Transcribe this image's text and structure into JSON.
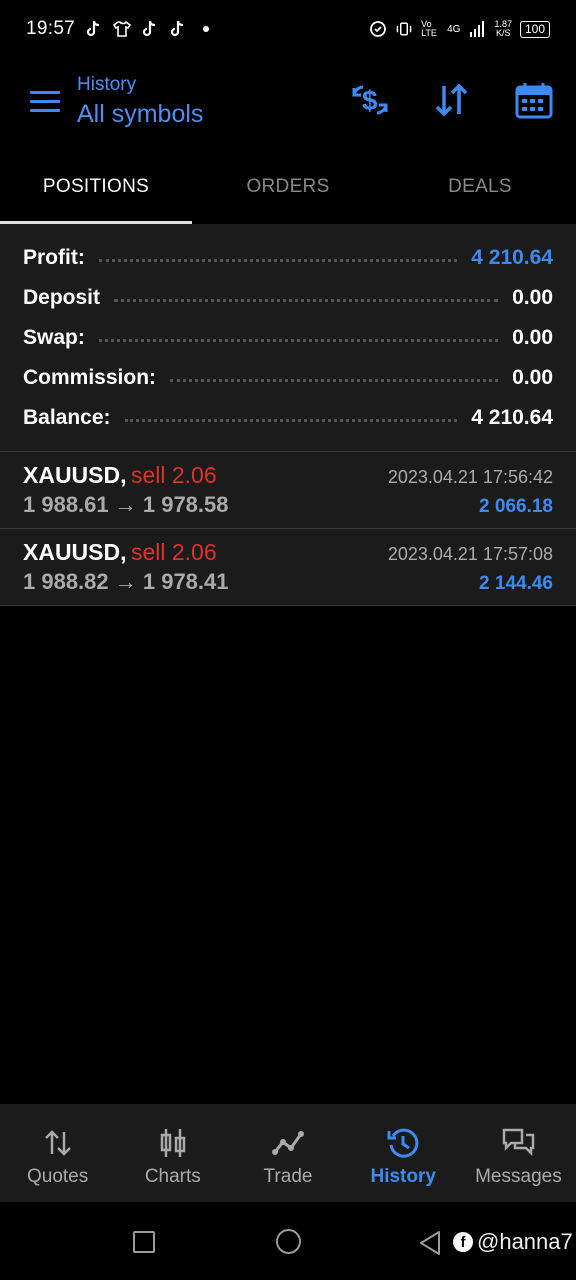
{
  "status_bar": {
    "time": "19:57",
    "network": "4G",
    "volte": "Vo LTE",
    "speed_value": "1.87",
    "speed_unit": "K/S",
    "battery": "100"
  },
  "header": {
    "subtitle": "History",
    "title": "All symbols",
    "accent_color": "#3d8bf2"
  },
  "tabs": [
    {
      "label": "POSITIONS",
      "active": true
    },
    {
      "label": "ORDERS",
      "active": false
    },
    {
      "label": "DEALS",
      "active": false
    }
  ],
  "summary": {
    "profit_label": "Profit:",
    "profit_value": "4 210.64",
    "deposit_label": "Deposit",
    "deposit_value": "0.00",
    "swap_label": "Swap:",
    "swap_value": "0.00",
    "commission_label": "Commission:",
    "commission_value": "0.00",
    "balance_label": "Balance:",
    "balance_value": "4 210.64"
  },
  "positions": [
    {
      "symbol": "XAUUSD,",
      "side": "sell 2.06",
      "time": "2023.04.21 17:56:42",
      "prices": "1 988.61 → 1 978.58",
      "profit": "2 066.18"
    },
    {
      "symbol": "XAUUSD,",
      "side": "sell 2.06",
      "time": "2023.04.21 17:57:08",
      "prices": "1 988.82 → 1 978.41",
      "profit": "2 144.46"
    }
  ],
  "bottom_nav": [
    {
      "label": "Quotes",
      "icon": "quotes-icon"
    },
    {
      "label": "Charts",
      "icon": "charts-icon"
    },
    {
      "label": "Trade",
      "icon": "trade-icon"
    },
    {
      "label": "History",
      "icon": "history-icon",
      "active": true
    },
    {
      "label": "Messages",
      "icon": "messages-icon"
    }
  ],
  "watermark": "@hanna7"
}
